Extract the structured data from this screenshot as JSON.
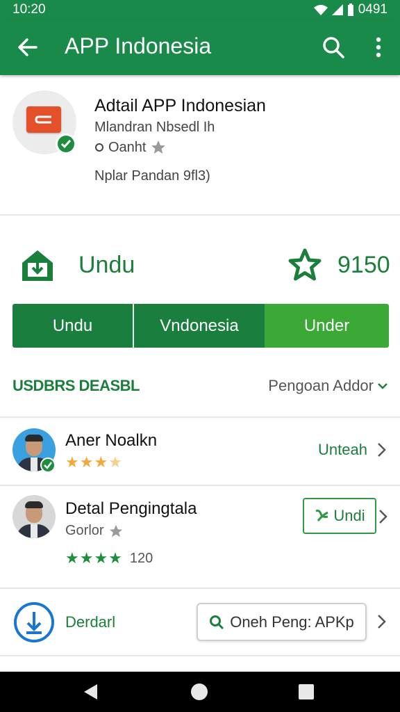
{
  "status_bar": {
    "time": "10:20",
    "right_text": "0491"
  },
  "app_bar": {
    "title": "APP Indonesia",
    "icons": [
      "back-arrow-icon",
      "search-icon",
      "more-vert-icon"
    ]
  },
  "app_header": {
    "title": "Adtail APP Indonesian",
    "developer": "Mlandran Nbsedl Ih",
    "rating_text": "Oanht",
    "subtitle": "Nplar Pandan 9fl3)"
  },
  "install_row": {
    "label": "Undu",
    "rating": "9150"
  },
  "tabs": [
    {
      "label": "Undu",
      "active": false
    },
    {
      "label": "Vndonesia",
      "active": false
    },
    {
      "label": "Under",
      "active": true
    }
  ],
  "section": {
    "title": "USDBRS DEASBL",
    "action": "Pengoan Addor"
  },
  "reviews": [
    {
      "name": "Aner Noalkn",
      "stars": 3.5,
      "link": "Unteah"
    },
    {
      "name": "Detal Pengingtala",
      "meta": "Gorlor",
      "stars_count": 4,
      "count": "120",
      "button": "Undi"
    }
  ],
  "download_row": {
    "label": "Derdarl",
    "search_button": "Oneh Peng: APKp"
  },
  "colors": {
    "primary": "#1a8a4a",
    "primary_dark": "#197e3e",
    "accent": "#3aa935",
    "star": "#f2a93b",
    "star_green": "#1e8e3e"
  }
}
